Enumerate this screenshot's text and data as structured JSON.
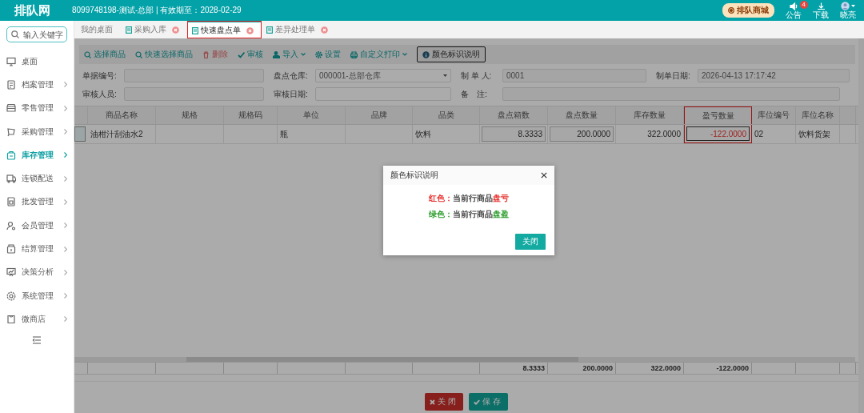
{
  "header": {
    "logo": "排队网",
    "account": "8099748198-测试-总部 | 有效期至：2028-02-29",
    "mall_button": "排队商城",
    "notice": {
      "label": "公告",
      "badge": "4"
    },
    "download": "下载",
    "user": "晓亮"
  },
  "sidebar": {
    "search": {
      "placeholder": "输入关键字"
    },
    "items": [
      {
        "label": "桌面",
        "selected": false,
        "has_children": false
      },
      {
        "label": "档案管理",
        "selected": false,
        "has_children": true
      },
      {
        "label": "零售管理",
        "selected": false,
        "has_children": true
      },
      {
        "label": "采购管理",
        "selected": false,
        "has_children": true
      },
      {
        "label": "库存管理",
        "selected": true,
        "has_children": true
      },
      {
        "label": "连锁配送",
        "selected": false,
        "has_children": true
      },
      {
        "label": "批发管理",
        "selected": false,
        "has_children": true
      },
      {
        "label": "会员管理",
        "selected": false,
        "has_children": true
      },
      {
        "label": "结算管理",
        "selected": false,
        "has_children": true
      },
      {
        "label": "决策分析",
        "selected": false,
        "has_children": true
      },
      {
        "label": "系统管理",
        "selected": false,
        "has_children": true
      },
      {
        "label": "微商店",
        "selected": false,
        "has_children": true
      }
    ]
  },
  "tabs": [
    {
      "label": "我的桌面",
      "selected": false,
      "closable": false,
      "highlighted": false
    },
    {
      "label": "采购入库",
      "selected": false,
      "closable": true,
      "highlighted": false
    },
    {
      "label": "快速盘点单",
      "selected": true,
      "closable": true,
      "highlighted": true
    },
    {
      "label": "差异处理单",
      "selected": false,
      "closable": true,
      "highlighted": false
    }
  ],
  "toolbar": [
    {
      "label": "选择商品",
      "kind": "plain",
      "dropdown": false
    },
    {
      "label": "快速选择商品",
      "kind": "plain",
      "dropdown": false
    },
    {
      "label": "删除",
      "kind": "danger",
      "dropdown": false
    },
    {
      "label": "审核",
      "kind": "plain",
      "dropdown": false
    },
    {
      "label": "导入",
      "kind": "plain",
      "dropdown": true
    },
    {
      "label": "设置",
      "kind": "plain",
      "dropdown": false
    },
    {
      "label": "自定义打印",
      "kind": "plain",
      "dropdown": true
    },
    {
      "label": "颜色标识说明",
      "kind": "outlined",
      "dropdown": false
    }
  ],
  "form": [
    [
      {
        "label": "单据编号:",
        "kind": "input"
      },
      {
        "label": "盘点仓库:",
        "kind": "select",
        "value": "000001-总部仓库"
      },
      {
        "label": "制 单 人:",
        "kind": "input",
        "value": "0001"
      },
      {
        "label": "制单日期:",
        "kind": "input",
        "value": "2026-04-13 17:17:42"
      }
    ],
    [
      {
        "label": "审核人员:",
        "kind": "input"
      },
      {
        "label": "审核日期:",
        "kind": "input"
      },
      {
        "label": "备　注:",
        "kind": "wide"
      }
    ]
  ],
  "table": {
    "columns": [
      {
        "label": "商品名称",
        "kind": "text"
      },
      {
        "label": "规格",
        "kind": "text"
      },
      {
        "label": "规格码",
        "kind": "text"
      },
      {
        "label": "单位",
        "kind": "text"
      },
      {
        "label": "品牌",
        "kind": "text"
      },
      {
        "label": "品类",
        "kind": "text"
      },
      {
        "label": "盘点箱数",
        "kind": "input",
        "total": "8.3333"
      },
      {
        "label": "盘点数量",
        "kind": "input",
        "total": "200.0000"
      },
      {
        "label": "库存数量",
        "kind": "number",
        "total": "322.0000"
      },
      {
        "label": "盈亏数量",
        "kind": "focus",
        "total": "-122.0000",
        "highlighted": true
      },
      {
        "label": "库位编号",
        "kind": "text"
      },
      {
        "label": "库位名称",
        "kind": "text"
      }
    ],
    "rows": [
      {
        "selected": true,
        "cells": [
          "油柑汁刮油水2",
          null,
          null,
          "瓶",
          null,
          "饮料",
          "8.3333",
          "200.0000",
          "322.0000",
          "-122.0000",
          "02",
          "饮料货架"
        ]
      }
    ]
  },
  "actions": [
    {
      "label": "关闭",
      "kind": "danger"
    },
    {
      "label": "保存",
      "kind": "primary"
    }
  ],
  "dialog": {
    "title": "颜色标识说明",
    "legend": [
      {
        "label": "红色：",
        "text": "当前行商品",
        "keyword": "盘亏",
        "color": "#e8332f"
      },
      {
        "label": "绿色：",
        "text": "当前行商品",
        "keyword": "盘盈",
        "color": "#2e9e2e"
      }
    ],
    "button": "关闭"
  }
}
